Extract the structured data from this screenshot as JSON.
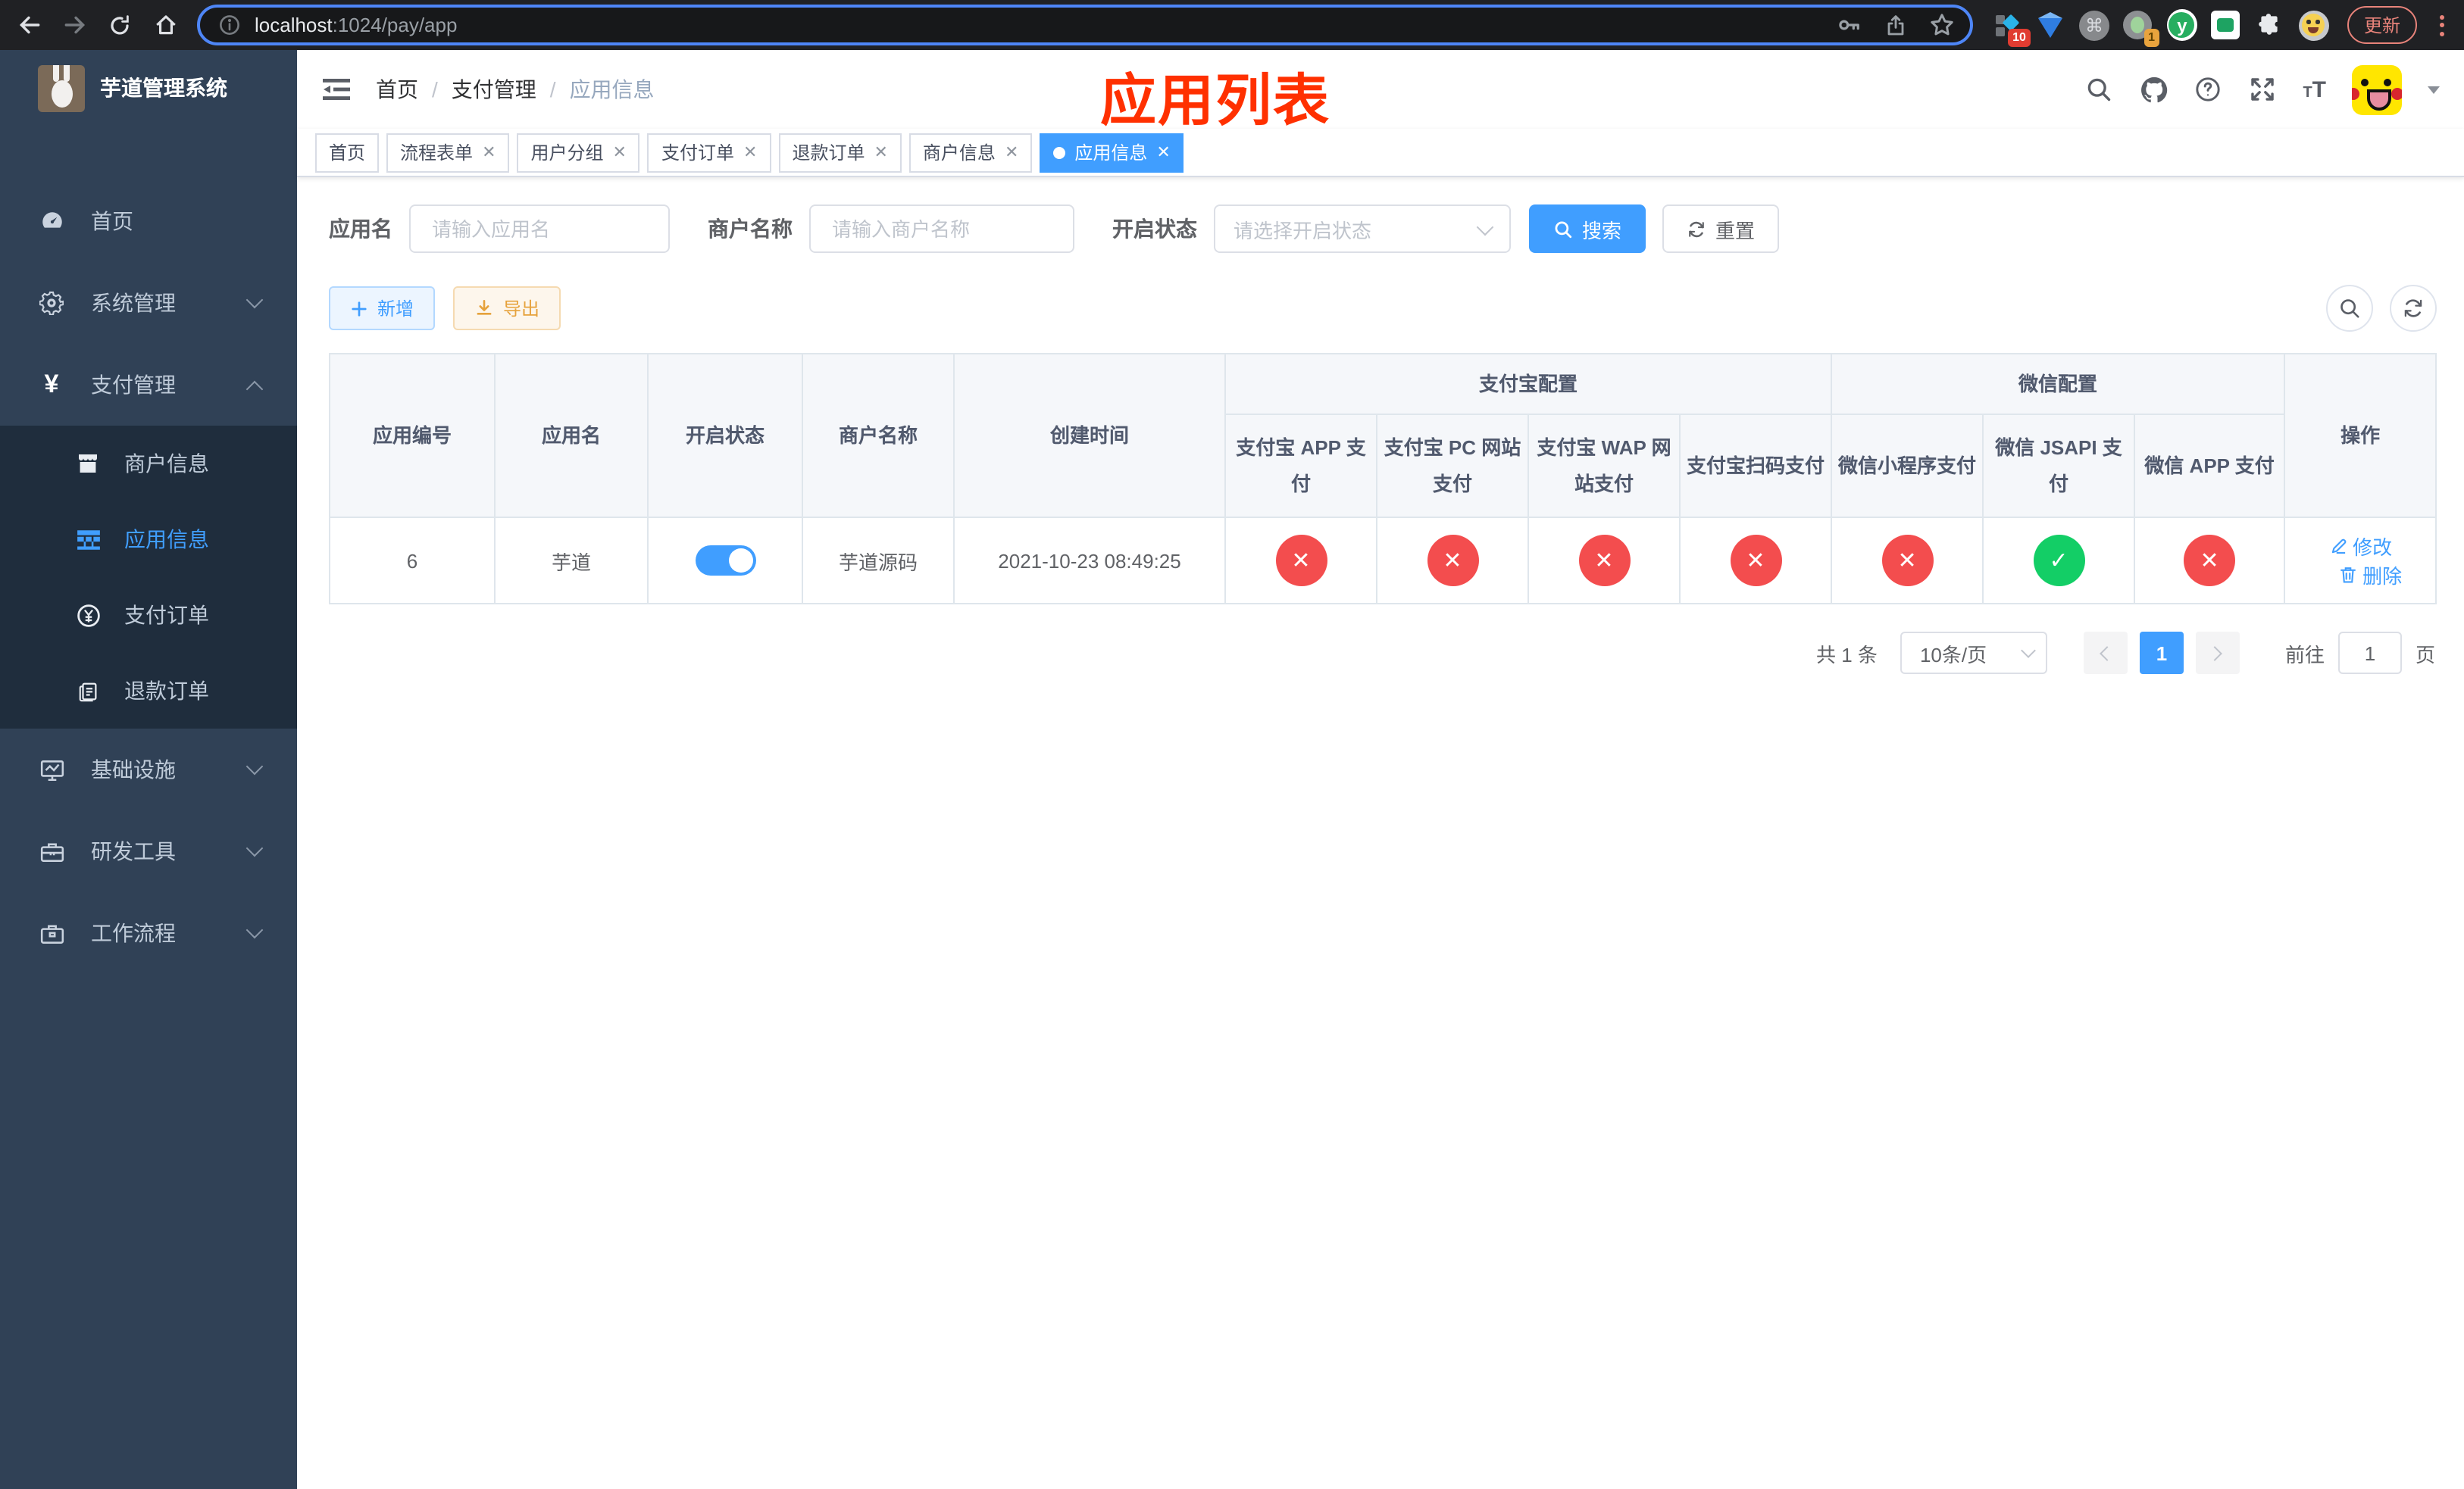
{
  "browser": {
    "url": {
      "host": "localhost",
      "path": ":1024/pay/app"
    },
    "update_button": "更新",
    "extensions": {
      "grid_badge": "10",
      "tab_badge": "1",
      "y_label": "y",
      "command_glyph": "⌘"
    }
  },
  "annotation": {
    "title": "应用列表"
  },
  "sidebar": {
    "app_title": "芋道管理系统",
    "items": [
      {
        "label": "首页"
      },
      {
        "label": "系统管理"
      },
      {
        "label": "支付管理"
      },
      {
        "label": "商户信息"
      },
      {
        "label": "应用信息"
      },
      {
        "label": "支付订单"
      },
      {
        "label": "退款订单"
      },
      {
        "label": "基础设施"
      },
      {
        "label": "研发工具"
      },
      {
        "label": "工作流程"
      }
    ]
  },
  "breadcrumb": {
    "items": [
      "首页",
      "支付管理",
      "应用信息"
    ]
  },
  "tabs": [
    {
      "label": "首页"
    },
    {
      "label": "流程表单"
    },
    {
      "label": "用户分组"
    },
    {
      "label": "支付订单"
    },
    {
      "label": "退款订单"
    },
    {
      "label": "商户信息"
    },
    {
      "label": "应用信息"
    }
  ],
  "filters": {
    "app_name_label": "应用名",
    "app_name_placeholder": "请输入应用名",
    "merchant_label": "商户名称",
    "merchant_placeholder": "请输入商户名称",
    "status_label": "开启状态",
    "status_placeholder": "请选择开启状态",
    "search_button": "搜索",
    "reset_button": "重置"
  },
  "toolbar": {
    "add_button": "新增",
    "export_button": "导出"
  },
  "table": {
    "columns": [
      "应用编号",
      "应用名",
      "开启状态",
      "商户名称",
      "创建时间"
    ],
    "groups": {
      "alipay": "支付宝配置",
      "wechat": "微信配置"
    },
    "sub_columns": [
      "支付宝 APP 支付",
      "支付宝 PC 网站支付",
      "支付宝 WAP 网站支付",
      "支付宝扫码支付",
      "微信小程序支付",
      "微信 JSAPI 支付",
      "微信 APP 支付"
    ],
    "actions_column": "操作",
    "row": {
      "id": "6",
      "name": "芋道",
      "enabled": true,
      "merchant": "芋道源码",
      "created_at": "2021-10-23 08:49:25",
      "statuses": [
        false,
        false,
        false,
        false,
        false,
        true,
        false
      ],
      "edit": "修改",
      "delete": "删除"
    }
  },
  "pagination": {
    "total": "共 1 条",
    "page_size": "10条/页",
    "current_page": "1",
    "goto_label": "前往",
    "goto_value": "1",
    "goto_suffix": "页"
  },
  "colors": {
    "accent": "#409eff",
    "danger": "#f34d4e",
    "success": "#13ce66",
    "sidebar": "#304156",
    "annotation": "#ff3000"
  }
}
